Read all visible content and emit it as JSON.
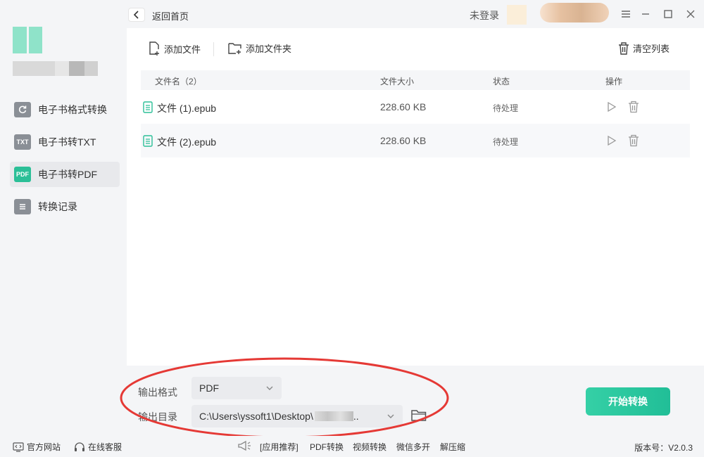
{
  "titlebar": {
    "back_label": "返回首页",
    "login_text": "未登录",
    "controls": [
      "menu-icon",
      "minimize-icon",
      "maximize-icon",
      "close-icon"
    ]
  },
  "sidebar": {
    "items": [
      {
        "label": "电子书格式转换",
        "icon": "refresh-icon"
      },
      {
        "label": "电子书转TXT",
        "icon": "TXT"
      },
      {
        "label": "电子书转PDF",
        "icon": "PDF",
        "active": true
      },
      {
        "label": "转换记录",
        "icon": "list-icon"
      }
    ]
  },
  "toolbar": {
    "add_file": "添加文件",
    "add_folder": "添加文件夹",
    "clear_list": "清空列表"
  },
  "table": {
    "headers": {
      "name": "文件名（2）",
      "size": "文件大小",
      "status": "状态",
      "action": "操作"
    },
    "rows": [
      {
        "name": "文件 (1).epub",
        "size": "228.60 KB",
        "status": "待处理"
      },
      {
        "name": "文件 (2).epub",
        "size": "228.60 KB",
        "status": "待处理"
      }
    ]
  },
  "settings": {
    "format_label": "输出格式",
    "format_value": "PDF",
    "dir_label": "输出目录",
    "dir_value": "C:\\Users\\yssoft1\\Desktop\\",
    "dir_suffix": "..",
    "start_button": "开始转换"
  },
  "footer": {
    "website": "官方网站",
    "support": "在线客服",
    "promo_label": "[应用推荐]",
    "promo_items": [
      "PDF转换",
      "视频转换",
      "微信多开",
      "解压缩"
    ],
    "version": "版本号：V2.0.3"
  },
  "colors": {
    "accent": "#2bbf97",
    "highlight_ellipse": "#e53935"
  }
}
